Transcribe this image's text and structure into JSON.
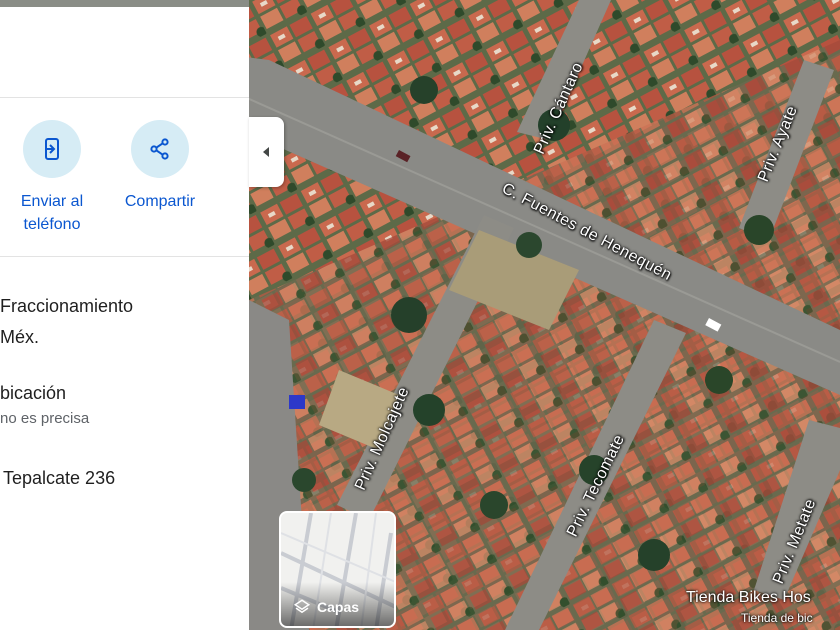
{
  "actions": {
    "send_to_phone_line1": "Enviar al",
    "send_to_phone_line2": "teléfono",
    "share": "Compartir"
  },
  "info": {
    "address_line1": "Fraccionamiento",
    "address_line2": "Méx.",
    "location_title": "bicación",
    "location_note": "no es precisa",
    "plus_code": "Tepalcate 236"
  },
  "map": {
    "streets": {
      "cantaro": "Priv. Cántaro",
      "ayate": "Priv. Ayate",
      "fuentes": "C. Fuentes de Henequén",
      "molcajete": "Priv. Molcajete",
      "tecomate": "Priv. Tecomate",
      "metate": "Priv. Metate"
    },
    "poi_1": "Tienda Bikes Hos",
    "poi_2": "Tienda de bic",
    "layers_label": "Capas"
  },
  "colors": {
    "accent": "#0b57d0",
    "action_circle": "#d6ecf5"
  }
}
